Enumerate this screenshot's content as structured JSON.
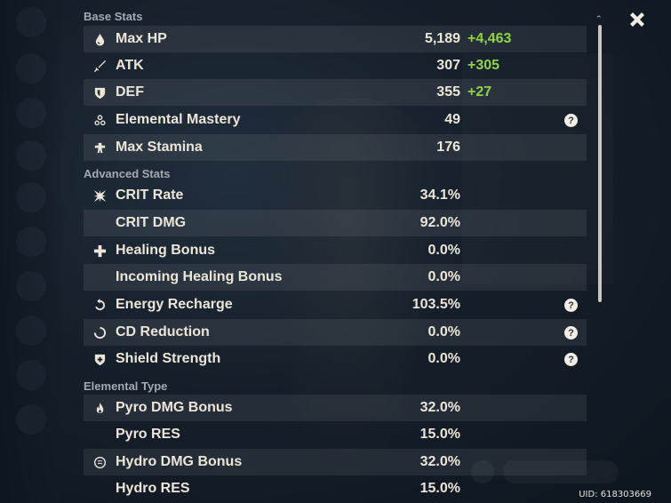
{
  "sections": {
    "base": "Base Stats",
    "advanced": "Advanced Stats",
    "elemental": "Elemental Type"
  },
  "base_stats": [
    {
      "label": "Max HP",
      "value": "5,189",
      "bonus": "+4,463",
      "icon": "hp-drop-icon"
    },
    {
      "label": "ATK",
      "value": "307",
      "bonus": "+305",
      "icon": "sword-icon"
    },
    {
      "label": "DEF",
      "value": "355",
      "bonus": "+27",
      "icon": "shield-icon"
    },
    {
      "label": "Elemental Mastery",
      "value": "49",
      "help": "?",
      "icon": "mastery-icon"
    },
    {
      "label": "Max Stamina",
      "value": "176",
      "icon": "stamina-icon"
    }
  ],
  "advanced_stats": [
    {
      "label": "CRIT Rate",
      "value": "34.1%",
      "icon": "crit-icon"
    },
    {
      "label": "CRIT DMG",
      "value": "92.0%"
    },
    {
      "label": "Healing Bonus",
      "value": "0.0%",
      "icon": "cross-icon"
    },
    {
      "label": "Incoming Healing Bonus",
      "value": "0.0%"
    },
    {
      "label": "Energy Recharge",
      "value": "103.5%",
      "help": "?",
      "icon": "recharge-icon"
    },
    {
      "label": "CD Reduction",
      "value": "0.0%",
      "help": "?",
      "icon": "cooldown-icon"
    },
    {
      "label": "Shield Strength",
      "value": "0.0%",
      "help": "?",
      "icon": "shield-strength-icon"
    }
  ],
  "elemental_stats": [
    {
      "label": "Pyro DMG Bonus",
      "value": "32.0%",
      "icon": "pyro-icon"
    },
    {
      "label": "Pyro RES",
      "value": "15.0%"
    },
    {
      "label": "Hydro DMG Bonus",
      "value": "32.0%",
      "icon": "hydro-icon"
    },
    {
      "label": "Hydro RES",
      "value": "15.0%"
    }
  ],
  "close_icon": "close-icon",
  "uid": "UID: 618303669",
  "colors": {
    "bonus": "#8fd447",
    "text": "#ece5d8",
    "section": "#a3a9b2"
  }
}
